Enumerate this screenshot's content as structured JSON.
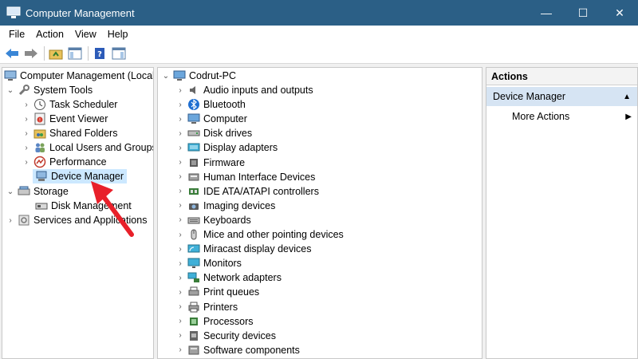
{
  "window": {
    "title": "Computer Management",
    "minimize": "—",
    "maximize": "☐",
    "close": "✕"
  },
  "menu": [
    "File",
    "Action",
    "View",
    "Help"
  ],
  "left_tree": {
    "root": "Computer Management (Local",
    "system_tools": "System Tools",
    "system_items": [
      "Task Scheduler",
      "Event Viewer",
      "Shared Folders",
      "Local Users and Groups",
      "Performance",
      "Device Manager"
    ],
    "storage": "Storage",
    "disk_management": "Disk Management",
    "services": "Services and Applications"
  },
  "device_tree": {
    "root": "Codrut-PC",
    "items": [
      {
        "label": "Audio inputs and outputs",
        "icon": "speaker-icon"
      },
      {
        "label": "Bluetooth",
        "icon": "bluetooth-icon"
      },
      {
        "label": "Computer",
        "icon": "computer-icon"
      },
      {
        "label": "Disk drives",
        "icon": "disk-drive-icon"
      },
      {
        "label": "Display adapters",
        "icon": "display-adapter-icon"
      },
      {
        "label": "Firmware",
        "icon": "firmware-icon"
      },
      {
        "label": "Human Interface Devices",
        "icon": "hid-icon"
      },
      {
        "label": "IDE ATA/ATAPI controllers",
        "icon": "ide-controller-icon"
      },
      {
        "label": "Imaging devices",
        "icon": "camera-icon"
      },
      {
        "label": "Keyboards",
        "icon": "keyboard-icon"
      },
      {
        "label": "Mice and other pointing devices",
        "icon": "mouse-icon"
      },
      {
        "label": "Miracast display devices",
        "icon": "miracast-icon"
      },
      {
        "label": "Monitors",
        "icon": "monitor-icon"
      },
      {
        "label": "Network adapters",
        "icon": "network-icon"
      },
      {
        "label": "Print queues",
        "icon": "print-queue-icon"
      },
      {
        "label": "Printers",
        "icon": "printer-icon"
      },
      {
        "label": "Processors",
        "icon": "processor-icon"
      },
      {
        "label": "Security devices",
        "icon": "security-icon"
      },
      {
        "label": "Software components",
        "icon": "software-icon"
      }
    ]
  },
  "actions": {
    "header": "Actions",
    "section": "Device Manager",
    "more": "More Actions"
  },
  "colors": {
    "titlebar": "#2b5f86",
    "selection": "#cce8ff",
    "actions_section": "#d6e4f3",
    "arrow": "#e8202a"
  }
}
